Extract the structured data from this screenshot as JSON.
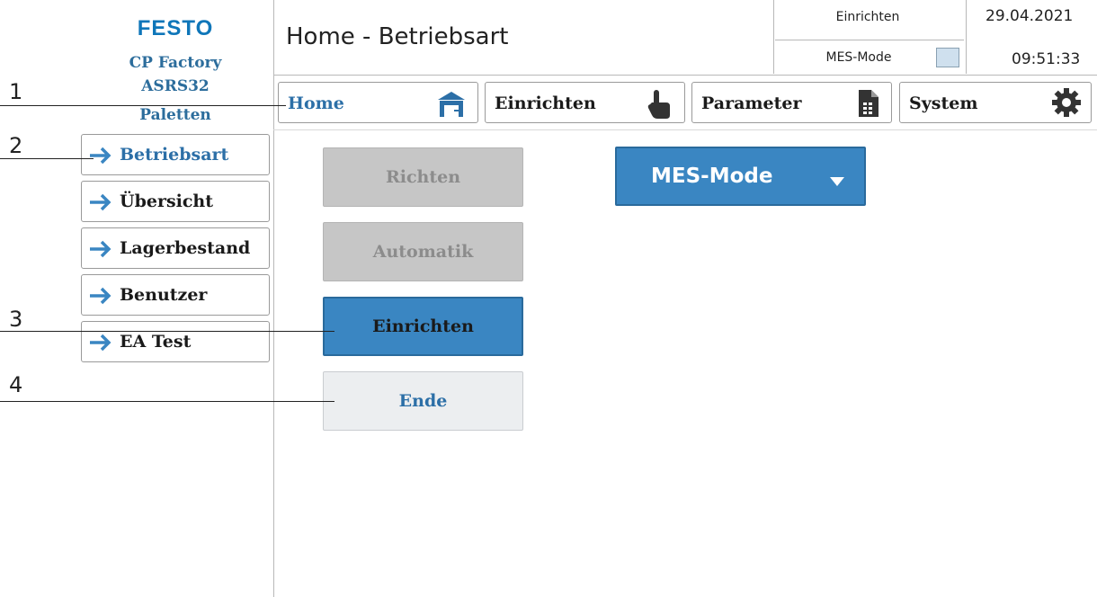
{
  "brand": {
    "logo": "FESTO",
    "station_line1": "CP Factory",
    "station_line2": "ASRS32",
    "station_line3": "Paletten"
  },
  "header": {
    "title": "Home - Betriebsart",
    "mode_text": "Einrichten",
    "mes_label": "MES-Mode",
    "date": "29.04.2021",
    "time": "09:51:33"
  },
  "tabs": [
    {
      "label": "Home",
      "icon": "home-icon"
    },
    {
      "label": "Einrichten",
      "icon": "hand-pointer-icon"
    },
    {
      "label": "Parameter",
      "icon": "document-icon"
    },
    {
      "label": "System",
      "icon": "gear-icon"
    }
  ],
  "sidebar": {
    "items": [
      {
        "label": "Betriebsart"
      },
      {
        "label": "Übersicht"
      },
      {
        "label": "Lagerbestand"
      },
      {
        "label": "Benutzer"
      },
      {
        "label": "EA Test"
      }
    ]
  },
  "modes": {
    "richten": "Richten",
    "automatik": "Automatik",
    "einrichten": "Einrichten",
    "ende": "Ende"
  },
  "mes_dropdown": {
    "selected": "MES-Mode"
  },
  "callouts": [
    "1",
    "2",
    "3",
    "4"
  ],
  "colors": {
    "accent": "#3a86c2",
    "brand": "#0f76b9",
    "active_text": "#2c6fa7",
    "disabled": "#c6c6c6"
  }
}
